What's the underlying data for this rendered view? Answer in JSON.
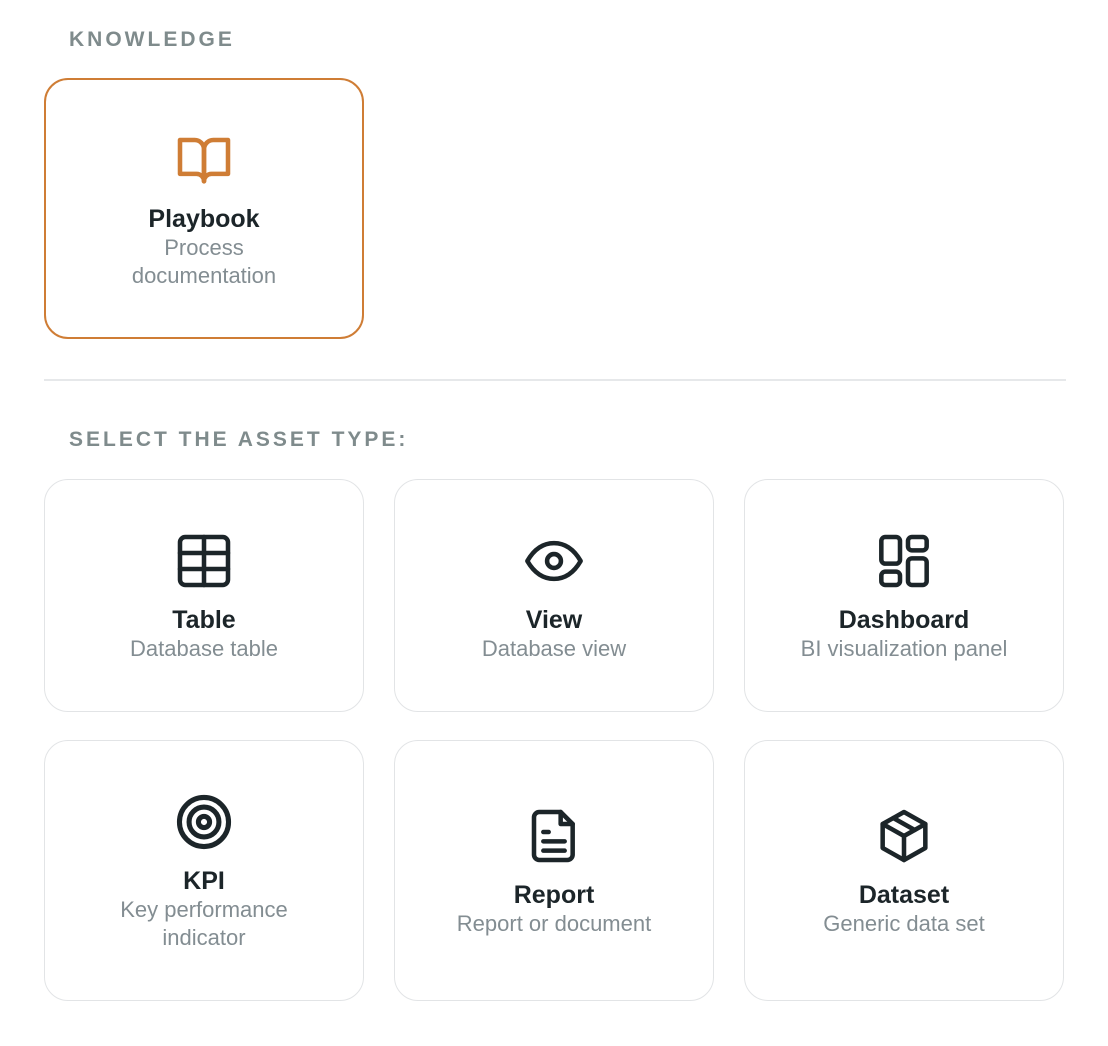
{
  "knowledge": {
    "heading": "KNOWLEDGE",
    "cards": [
      {
        "title": "Playbook",
        "description": "Process documentation",
        "icon": "book-icon",
        "selected": true
      }
    ]
  },
  "asset_types": {
    "heading": "SELECT THE ASSET TYPE:",
    "cards": [
      {
        "title": "Table",
        "description": "Database table",
        "icon": "table-icon"
      },
      {
        "title": "View",
        "description": "Database view",
        "icon": "eye-icon"
      },
      {
        "title": "Dashboard",
        "description": "BI visualization panel",
        "icon": "dashboard-icon"
      },
      {
        "title": "KPI",
        "description": "Key performance indicator",
        "icon": "target-icon"
      },
      {
        "title": "Report",
        "description": "Report or document",
        "icon": "document-icon"
      },
      {
        "title": "Dataset",
        "description": "Generic data set",
        "icon": "box-icon"
      }
    ]
  },
  "colors": {
    "accent": "#cf7d35",
    "icon": "#1c2529",
    "heading": "#7f8b8c",
    "description": "#838d92",
    "border": "#e2e4e6"
  }
}
